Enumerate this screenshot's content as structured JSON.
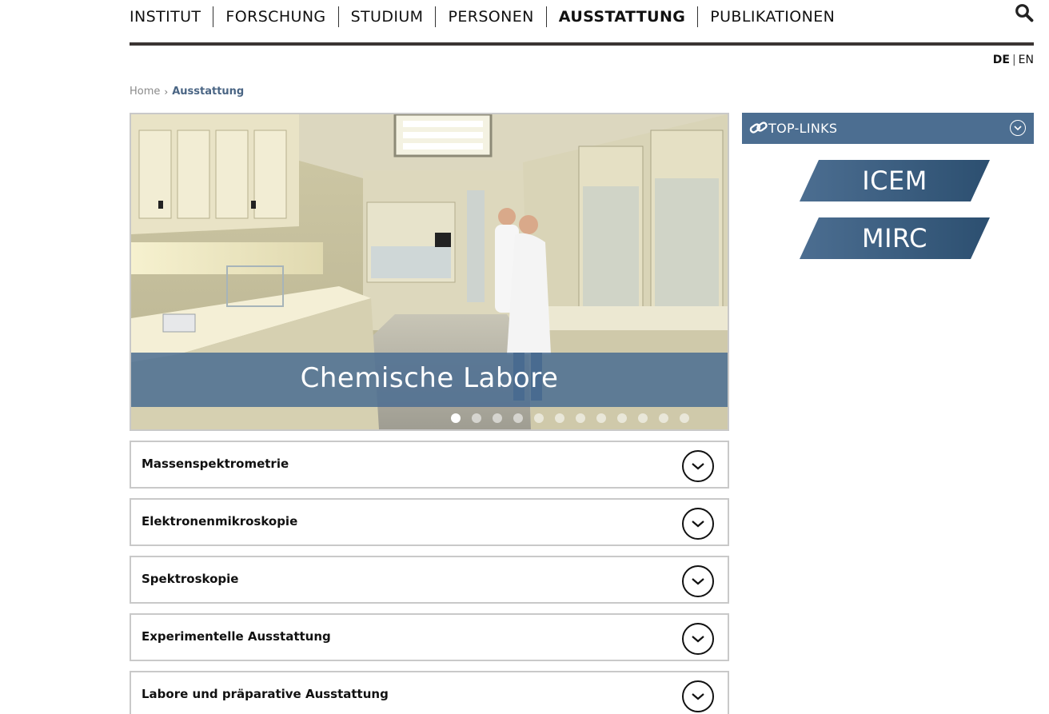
{
  "nav": {
    "items": [
      {
        "label": "INSTITUT"
      },
      {
        "label": "FORSCHUNG"
      },
      {
        "label": "STUDIUM"
      },
      {
        "label": "PERSONEN"
      },
      {
        "label": "AUSSTATTUNG"
      },
      {
        "label": "PUBLIKATIONEN"
      }
    ],
    "search_icon": "search-icon"
  },
  "lang": {
    "de": "DE",
    "separator": "|",
    "en": "EN",
    "active": "DE"
  },
  "breadcrumb": {
    "home": "Home",
    "separator_icon": "chevron-right-icon",
    "separator": "›",
    "current": "Ausstattung"
  },
  "hero": {
    "caption": "Chemische Labore",
    "slide_count": 12,
    "active_slide": 1
  },
  "accordion": {
    "items": [
      {
        "title": "Massenspektrometrie"
      },
      {
        "title": "Elektronenmikroskopie"
      },
      {
        "title": "Spektroskopie"
      },
      {
        "title": "Experimentelle Ausstattung"
      },
      {
        "title": "Labore und präparative Ausstattung"
      }
    ],
    "toggle_icon": "chevron-down-icon"
  },
  "sidebar": {
    "title": "TOP-LINKS",
    "icon": "link-icon",
    "links": [
      {
        "label": "ICEM"
      },
      {
        "label": "MIRC"
      }
    ]
  },
  "colors": {
    "accent": "#4c6e91",
    "badge_dark": "#2c4f70",
    "nav_rule": "#3a3533"
  }
}
